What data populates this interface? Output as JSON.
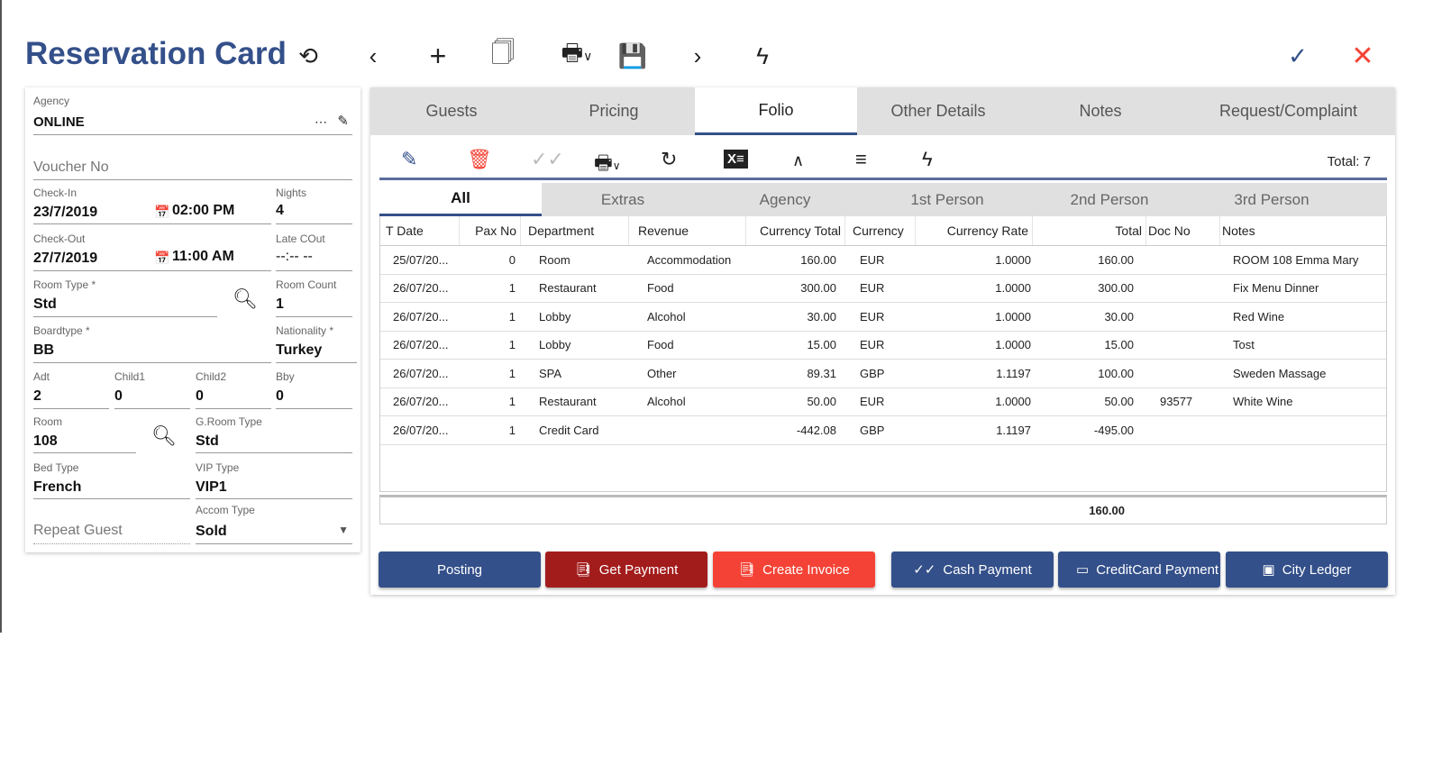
{
  "header": {
    "title": "Reservation Card"
  },
  "toolbar_icons": [
    "history-icon",
    "chevron-left-icon",
    "plus-icon",
    "copy-icon",
    "print-icon",
    "save-icon",
    "chevron-right-icon",
    "flash-icon",
    "check-icon",
    "close-icon"
  ],
  "colors": {
    "primary": "#34508a",
    "danger_dark": "#a31c1c",
    "danger": "#f44336",
    "accent_text": "#34508a"
  },
  "form": {
    "agency": {
      "label": "Agency",
      "value": "ONLINE"
    },
    "voucher": {
      "placeholder": "Voucher No"
    },
    "checkin": {
      "label": "Check-In",
      "date": "23/7/2019",
      "time": "02:00 PM"
    },
    "nights": {
      "label": "Nights",
      "value": "4"
    },
    "checkout": {
      "label": "Check-Out",
      "date": "27/7/2019",
      "time": "11:00 AM"
    },
    "late_cout": {
      "label": "Late COut",
      "value": "--:-- --"
    },
    "room_type": {
      "label": "Room Type *",
      "value": "Std"
    },
    "room_count": {
      "label": "Room Count",
      "value": "1"
    },
    "boardtype": {
      "label": "Boardtype *",
      "value": "BB"
    },
    "nationality": {
      "label": "Nationality *",
      "value": "Turkey"
    },
    "adt": {
      "label": "Adt",
      "value": "2"
    },
    "child1": {
      "label": "Child1",
      "value": "0"
    },
    "child2": {
      "label": "Child2",
      "value": "0"
    },
    "bby": {
      "label": "Bby",
      "value": "0"
    },
    "room": {
      "label": "Room",
      "value": "108"
    },
    "g_room_type": {
      "label": "G.Room Type",
      "value": "Std"
    },
    "bed_type": {
      "label": "Bed Type",
      "value": "French"
    },
    "vip_type": {
      "label": "VIP Type",
      "value": "VIP1"
    },
    "repeat_guest": {
      "placeholder": "Repeat Guest"
    },
    "accom_type": {
      "label": "Accom Type",
      "value": "Sold"
    }
  },
  "tabs": [
    "Guests",
    "Pricing",
    "Folio",
    "Other Details",
    "Notes",
    "Request/Complaint"
  ],
  "active_tab": "Folio",
  "folio": {
    "total_label": "Total: 7",
    "subtabs": [
      "All",
      "Extras",
      "Agency",
      "1st Person",
      "2nd Person",
      "3rd Person"
    ],
    "active_subtab": "All",
    "columns": [
      "T Date",
      "Pax No",
      "Department",
      "Revenue",
      "Currency Total",
      "Currency",
      "Currency Rate",
      "Total",
      "Doc No",
      "Notes"
    ],
    "rows": [
      [
        "25/07/20...",
        "0",
        "Room",
        "Accommodation",
        "160.00",
        "EUR",
        "1.0000",
        "160.00",
        "",
        "ROOM 108 Emma Mary"
      ],
      [
        "26/07/20...",
        "1",
        "Restaurant",
        "Food",
        "300.00",
        "EUR",
        "1.0000",
        "300.00",
        "",
        "Fix Menu Dinner"
      ],
      [
        "26/07/20...",
        "1",
        "Lobby",
        "Alcohol",
        "30.00",
        "EUR",
        "1.0000",
        "30.00",
        "",
        "Red Wine"
      ],
      [
        "26/07/20...",
        "1",
        "Lobby",
        "Food",
        "15.00",
        "EUR",
        "1.0000",
        "15.00",
        "",
        "Tost"
      ],
      [
        "26/07/20...",
        "1",
        "SPA",
        "Other",
        "89.31",
        "GBP",
        "1.1197",
        "100.00",
        "",
        "Sweden Massage"
      ],
      [
        "26/07/20...",
        "1",
        "Restaurant",
        "Alcohol",
        "50.00",
        "EUR",
        "1.0000",
        "50.00",
        "93577",
        "White Wine"
      ],
      [
        "26/07/20...",
        "1",
        "Credit Card",
        "",
        "-442.08",
        "GBP",
        "1.1197",
        "-495.00",
        "",
        ""
      ]
    ],
    "footer_total": "160.00"
  },
  "buttons": {
    "posting": "Posting",
    "get_payment": "Get Payment",
    "create_invoice": "Create Invoice",
    "cash_payment": "Cash Payment",
    "creditcard_payment": "CreditCard Payment",
    "city_ledger": "City Ledger"
  }
}
